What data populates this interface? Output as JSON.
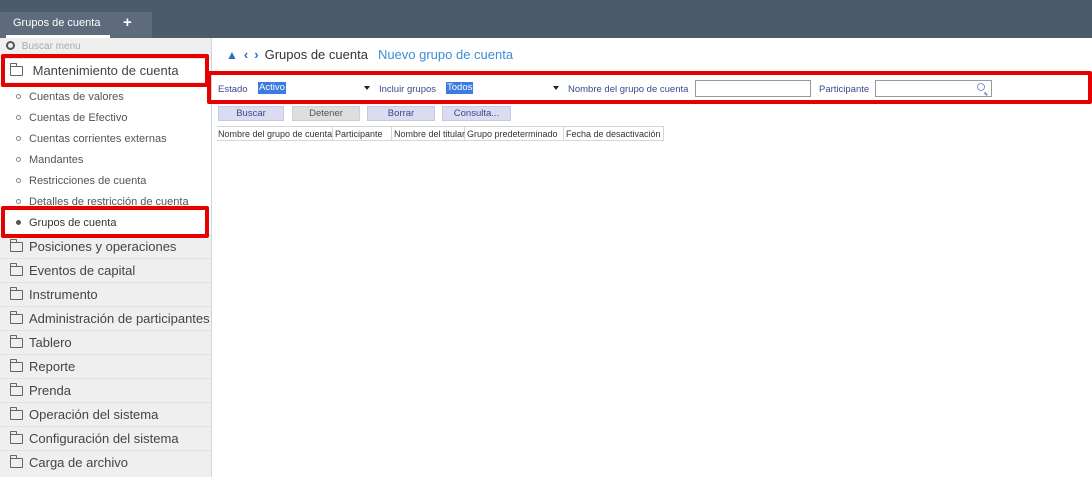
{
  "window": {
    "tab_label": "Grupos de cuenta",
    "add_tab_icon": "plus-icon"
  },
  "sidebar": {
    "search_placeholder": "Buscar menu",
    "folders_top": [
      {
        "label": "Mantenimiento de cuenta",
        "expanded": true
      }
    ],
    "subitems": [
      {
        "label": "Cuentas de valores"
      },
      {
        "label": "Cuentas de Efectivo"
      },
      {
        "label": "Cuentas corrientes externas"
      },
      {
        "label": "Mandantes"
      },
      {
        "label": "Restricciones de cuenta"
      },
      {
        "label": "Detalles de restricción de cuenta"
      },
      {
        "label": "Grupos de cuenta",
        "active": true
      }
    ],
    "folders": [
      {
        "label": "Posiciones y operaciones"
      },
      {
        "label": "Eventos de capital"
      },
      {
        "label": "Instrumento"
      },
      {
        "label": "Administración de participantes"
      },
      {
        "label": "Tablero"
      },
      {
        "label": "Reporte"
      },
      {
        "label": "Prenda"
      },
      {
        "label": "Operación del sistema"
      },
      {
        "label": "Configuración del sistema"
      },
      {
        "label": "Carga de archivo"
      }
    ]
  },
  "breadcrumb": {
    "current": "Grupos de cuenta",
    "action_link": "Nuevo grupo de cuenta"
  },
  "filters": {
    "estado_label": "Estado",
    "estado_value": "Activo",
    "incluir_label": "Incluir grupos",
    "incluir_value": "Todos",
    "nombre_label": "Nombre del grupo de cuenta",
    "nombre_value": "",
    "participante_label": "Participante",
    "participante_value": ""
  },
  "buttons": {
    "buscar": "Buscar",
    "detener": "Detener",
    "borrar": "Borrar",
    "consulta": "Consulta..."
  },
  "table": {
    "columns": [
      "Nombre del grupo de cuenta",
      "Participante",
      "Nombre del titular",
      "Grupo predeterminado",
      "Fecha de desactivación"
    ],
    "rows": []
  },
  "colors": {
    "topbar": "#4d5a6a",
    "highlight": "#e60000",
    "link": "#3a8fd6",
    "selection": "#3d7be0"
  }
}
